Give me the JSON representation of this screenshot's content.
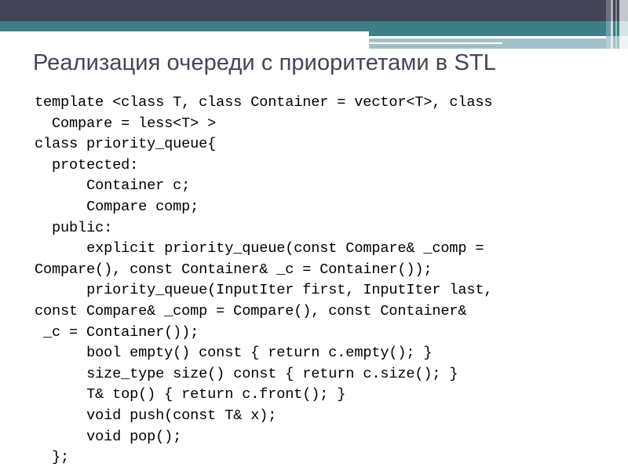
{
  "slide": {
    "title": "Реализация очереди с приоритетами в STL",
    "title_color": "#434557",
    "background_color": "#ffffff"
  },
  "decoration": {
    "dark_band_color": "#434557",
    "teal_band_color": "#3d7f85",
    "light_band_color": "#a3c0c9"
  },
  "code": {
    "language": "cpp",
    "lines": [
      "template <class T, class Container = vector<T>, class",
      "  Compare = less<T> >",
      "class priority_queue{",
      "  protected:",
      "      Container c;",
      "      Compare comp;",
      "  public:",
      "      explicit priority_queue(const Compare& _comp =",
      "Compare(), const Container& _c = Container());",
      "      priority_queue(InputIter first, InputIter last,",
      "const Compare& _comp = Compare(), const Container&",
      " _c = Container());",
      "      bool empty() const { return c.empty(); }",
      "      size_type size() const { return c.size(); }",
      "      T& top() { return c.front(); }",
      "      void push(const T& x);",
      "      void pop();",
      "  };"
    ]
  }
}
